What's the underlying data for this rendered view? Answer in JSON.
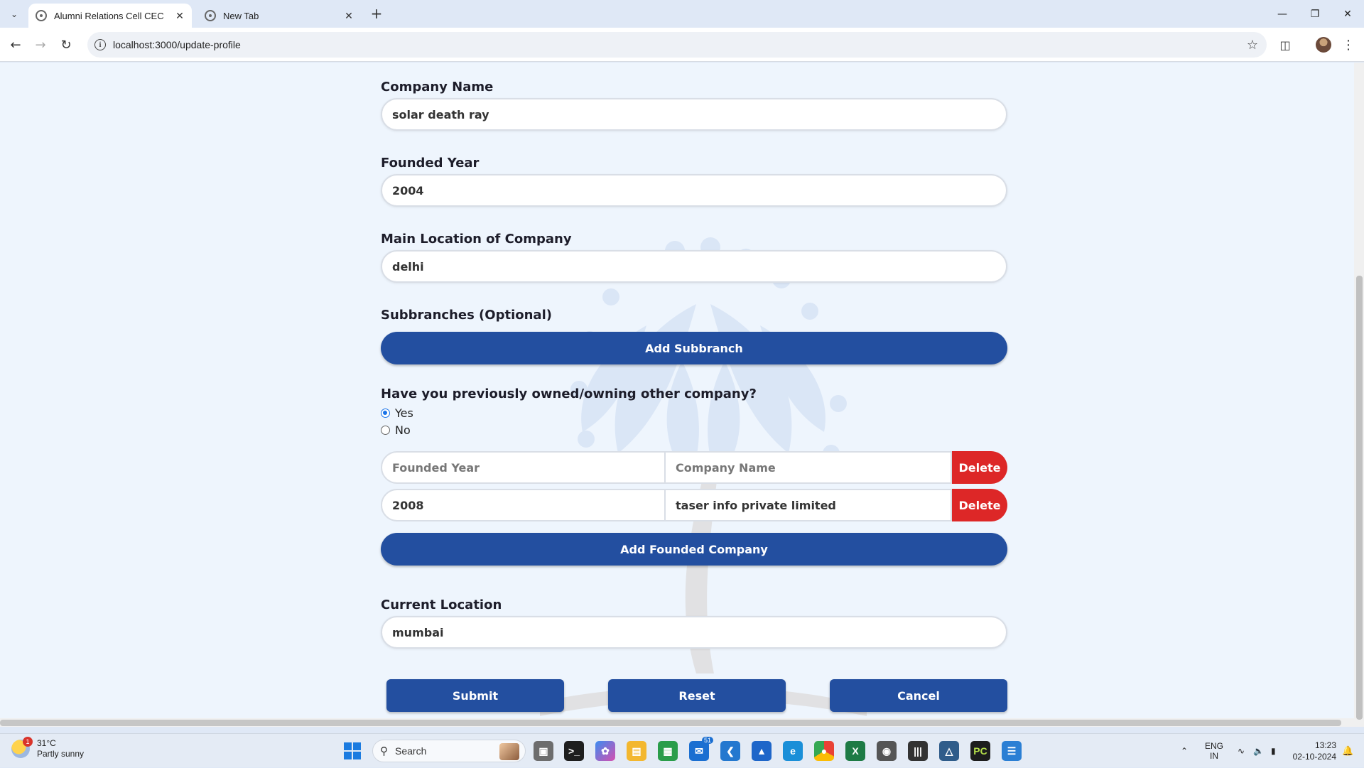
{
  "browser": {
    "tabs": [
      {
        "title": "Alumni Relations Cell CEC",
        "active": true
      },
      {
        "title": "New Tab",
        "active": false
      }
    ],
    "url": "localhost:3000/update-profile"
  },
  "form": {
    "company_name": {
      "label": "Company Name",
      "value": "solar death ray"
    },
    "founded_year": {
      "label": "Founded Year",
      "value": "2004"
    },
    "main_location": {
      "label": "Main Location of Company",
      "value": "delhi"
    },
    "subbranches": {
      "label": "Subbranches (Optional)",
      "button": "Add Subbranch"
    },
    "previously_owned": {
      "question": "Have you previously owned/owning other company?",
      "options": [
        "Yes",
        "No"
      ],
      "selected": "Yes"
    },
    "founded_companies": {
      "rows": [
        {
          "year": "",
          "name": "",
          "year_placeholder": "Founded Year",
          "name_placeholder": "Company Name",
          "delete": "Delete"
        },
        {
          "year": "2008",
          "name": "taser info private limited",
          "delete": "Delete"
        }
      ],
      "add_button": "Add Founded Company"
    },
    "current_location": {
      "label": "Current Location",
      "value": "mumbai"
    },
    "actions": {
      "submit": "Submit",
      "reset": "Reset",
      "cancel": "Cancel"
    }
  },
  "taskbar": {
    "weather": {
      "temp": "31°C",
      "desc": "Partly sunny",
      "badge": "1"
    },
    "search_label": "Search",
    "mail_badge": "51",
    "language": {
      "line1": "ENG",
      "line2": "IN"
    },
    "time": "13:23",
    "date": "02-10-2024"
  },
  "colors": {
    "primary_button": "#234fa0",
    "delete_button": "#dd2727",
    "page_background": "#eef5fd"
  }
}
